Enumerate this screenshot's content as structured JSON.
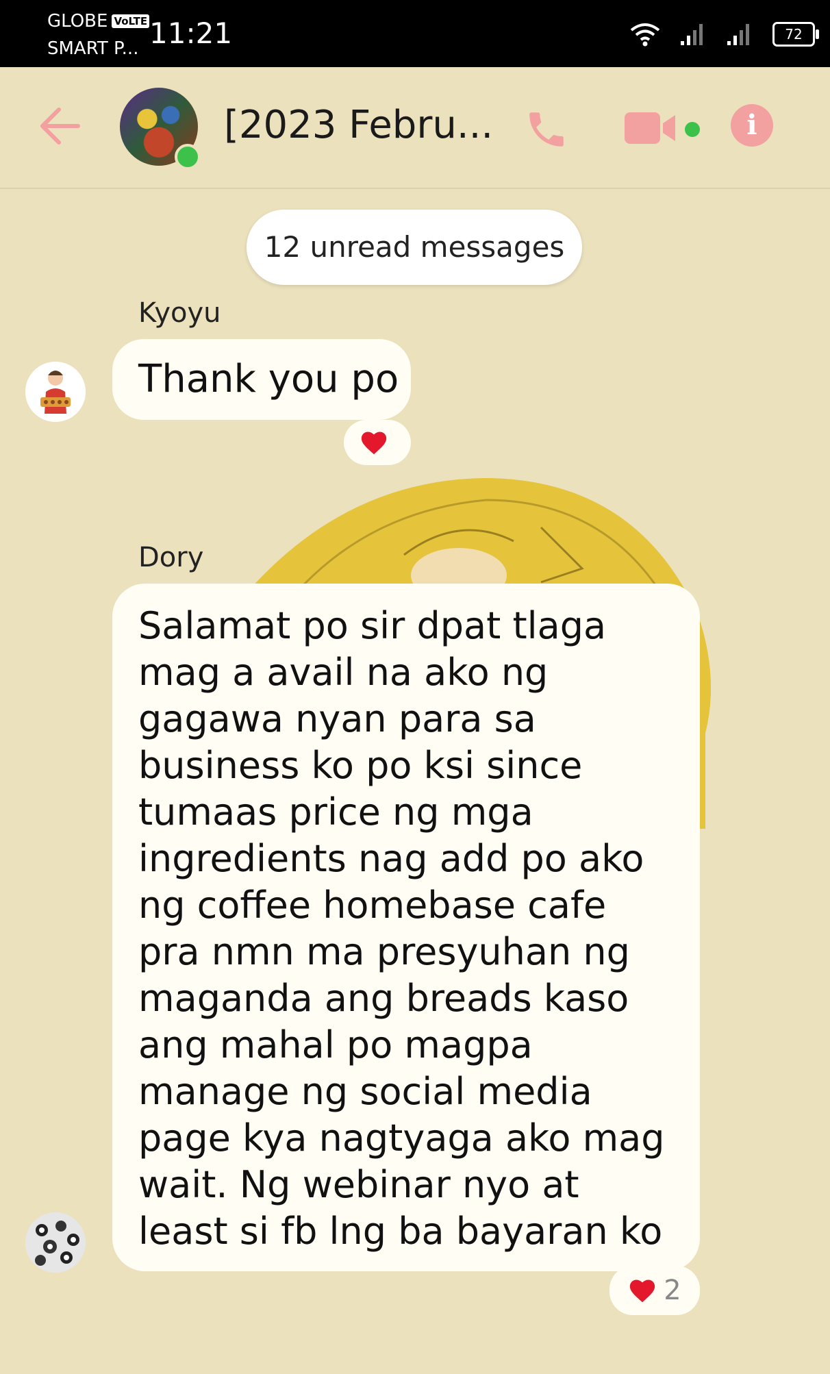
{
  "status_bar": {
    "carrier_1": "GLOBE",
    "carrier_1_badge": "VoLTE",
    "carrier_2": "SMART P...",
    "time": "11:21",
    "battery": "72"
  },
  "header": {
    "title": "[2023 Febru...",
    "online": true
  },
  "chat": {
    "unread_banner": "12 unread messages",
    "messages": [
      {
        "sender": "Kyoyu",
        "text": "Thank you po",
        "reaction_emoji": "heart",
        "reaction_count": ""
      },
      {
        "sender": "Dory",
        "text": "Salamat po sir dpat tlaga mag a avail na ako ng gagawa nyan para sa business ko po ksi since tumaas price ng mga ingredients nag add po ako ng coffee homebase cafe pra nmn ma presyuhan ng maganda ang breads kaso ang mahal po magpa manage ng social media page kya nagtyaga ako mag wait. Ng webinar nyo at least si fb lng ba bayaran ko",
        "reaction_emoji": "heart",
        "reaction_count": "2"
      }
    ]
  },
  "colors": {
    "background": "#ebe1bd",
    "accent": "#f2a0a0",
    "online": "#3cc24b",
    "bubble": "#fffdf4"
  }
}
